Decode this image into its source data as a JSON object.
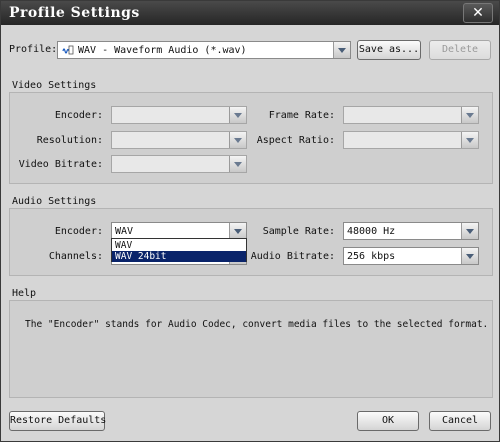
{
  "window": {
    "title": "Profile Settings",
    "close_label": "✕"
  },
  "profile": {
    "label": "Profile:",
    "value": "WAV - Waveform Audio (*.wav)",
    "icon": "wav-file-icon",
    "save_as_label": "Save as...",
    "delete_label": "Delete"
  },
  "video": {
    "title": "Video Settings",
    "encoder_label": "Encoder:",
    "resolution_label": "Resolution:",
    "bitrate_label": "Video Bitrate:",
    "frame_rate_label": "Frame Rate:",
    "aspect_ratio_label": "Aspect Ratio:"
  },
  "audio": {
    "title": "Audio Settings",
    "encoder_label": "Encoder:",
    "encoder_value": "WAV",
    "channels_label": "Channels:",
    "sample_rate_label": "Sample Rate:",
    "sample_rate_value": "48000 Hz",
    "bitrate_label": "Audio Bitrate:",
    "bitrate_value": "256 kbps",
    "encoder_options": [
      "WAV",
      "WAV 24bit"
    ]
  },
  "help": {
    "title": "Help",
    "text": "The \"Encoder\" stands for Audio Codec, convert media files to the selected format."
  },
  "footer": {
    "restore_label": "Restore Defaults",
    "ok_label": "OK",
    "cancel_label": "Cancel"
  },
  "colors": {
    "titlebar": "#262626",
    "selection": "#0a246a",
    "panel": "#cfcfcf"
  }
}
